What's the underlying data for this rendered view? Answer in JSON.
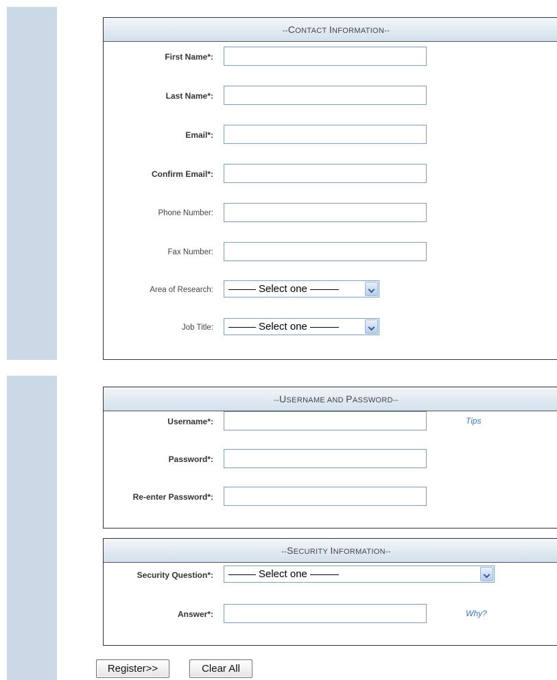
{
  "contact": {
    "header_prefix": "--",
    "header_w1_cap": "C",
    "header_w1_rest": "ONTACT",
    "header_w2_cap": "I",
    "header_w2_rest": "NFORMATION",
    "header_suffix": "--",
    "first_name_label": "First Name*:",
    "first_name_value": "",
    "last_name_label": "Last Name*:",
    "last_name_value": "",
    "email_label": "Email*:",
    "email_value": "",
    "confirm_email_label": "Confirm Email*:",
    "confirm_email_value": "",
    "phone_label": "Phone Number:",
    "phone_value": "",
    "fax_label": "Fax Number:",
    "fax_value": "",
    "research_label": "Area of Research:",
    "research_selected": "Select one",
    "job_label": "Job Title:",
    "job_selected": "Select one"
  },
  "credentials": {
    "header_prefix": "--",
    "header_w1_cap": "U",
    "header_w1_rest": "SERNAME AND",
    "header_w2_cap": "P",
    "header_w2_rest": "ASSWORD",
    "header_suffix": "--",
    "username_label": "Username*:",
    "username_value": "",
    "tips_link": "Tips",
    "password_label": "Password*:",
    "password_value": "",
    "reenter_label": "Re-enter Password*:",
    "reenter_value": ""
  },
  "security": {
    "header_prefix": "--",
    "header_w1_cap": "S",
    "header_w1_rest": "ECURITY",
    "header_w2_cap": "I",
    "header_w2_rest": "NFORMATION",
    "header_suffix": "--",
    "question_label": "Security Question*:",
    "question_selected": "Select one",
    "answer_label": "Answer*:",
    "answer_value": "",
    "why_link": "Why?"
  },
  "actions": {
    "register_label": "Register>>",
    "clear_label": "Clear All"
  },
  "colors": {
    "sidebar": "#cbd9e6",
    "header_gradient_top": "#f2f6fa",
    "header_gradient_bottom": "#d3e0ec",
    "link": "#3a77b5",
    "input_border": "#7f9db9"
  }
}
